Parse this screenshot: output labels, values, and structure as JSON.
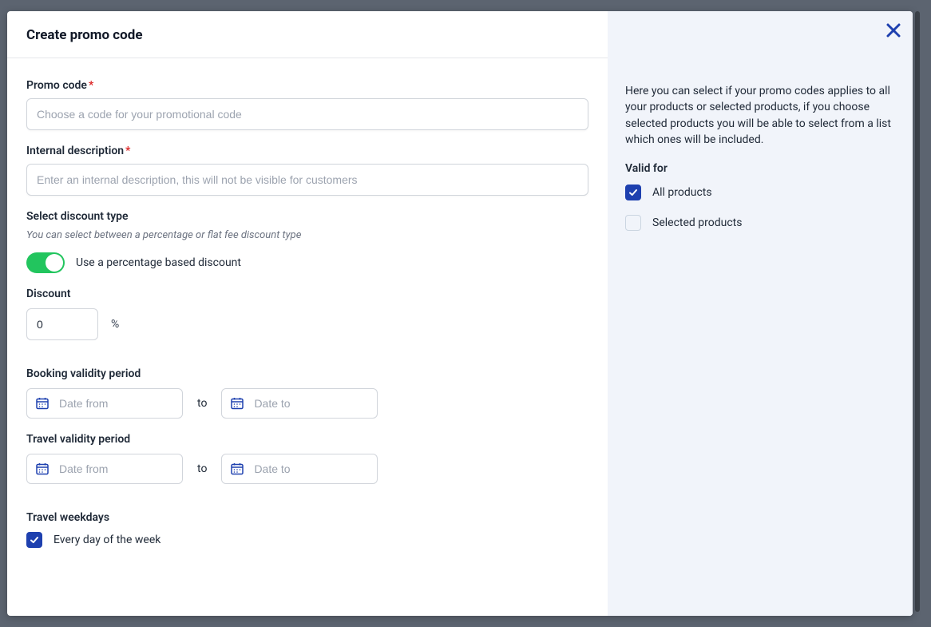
{
  "header": {
    "title": "Create promo code"
  },
  "form": {
    "promo_code": {
      "label": "Promo code",
      "required_marker": "*",
      "placeholder": "Choose a code for your promotional code",
      "value": ""
    },
    "internal_desc": {
      "label": "Internal description",
      "required_marker": "*",
      "placeholder": "Enter an internal description, this will not be visible for customers",
      "value": ""
    },
    "discount_type": {
      "label": "Select discount type",
      "hint": "You can select between a percentage or flat fee discount type",
      "toggle_label": "Use a percentage based discount",
      "toggle_on": true
    },
    "discount": {
      "label": "Discount",
      "value": "0",
      "unit": "%"
    },
    "booking_validity": {
      "label": "Booking validity period",
      "from_placeholder": "Date from",
      "to_label": "to",
      "to_placeholder": "Date to"
    },
    "travel_validity": {
      "label": "Travel validity period",
      "from_placeholder": "Date from",
      "to_label": "to",
      "to_placeholder": "Date to"
    },
    "travel_weekdays": {
      "label": "Travel weekdays",
      "every_day_label": "Every day of the week",
      "every_day_checked": true
    }
  },
  "side": {
    "description": "Here you can select if your promo codes applies to all your products or selected products, if you choose selected products you will be able to select from a list which ones will be included.",
    "valid_for_label": "Valid for",
    "all_products": {
      "label": "All products",
      "checked": true
    },
    "selected_products": {
      "label": "Selected products",
      "checked": false
    }
  }
}
